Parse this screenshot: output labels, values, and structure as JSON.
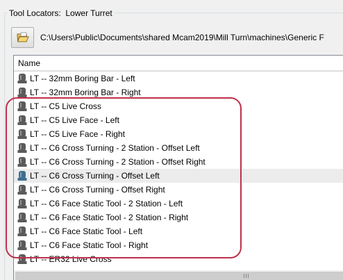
{
  "group": {
    "title": "Tool Locators:  Lower Turret"
  },
  "path": {
    "button_icon": "folder-open-icon",
    "text": "C:\\Users\\Public\\Documents\\shared Mcam2019\\Mill Turn\\machines\\Generic F"
  },
  "list": {
    "column_header": "Name",
    "items": [
      {
        "label": "LT -- 32mm Boring Bar - Left",
        "icon": "tool-locator-icon"
      },
      {
        "label": "LT -- 32mm Boring Bar - Right",
        "icon": "tool-locator-icon"
      },
      {
        "label": "LT -- C5 Live Cross",
        "icon": "tool-locator-icon"
      },
      {
        "label": "LT -- C5 Live Face - Left",
        "icon": "tool-locator-icon"
      },
      {
        "label": "LT -- C5 Live Face - Right",
        "icon": "tool-locator-icon"
      },
      {
        "label": "LT -- C6 Cross Turning - 2 Station - Offset Left",
        "icon": "tool-locator-icon"
      },
      {
        "label": "LT -- C6 Cross Turning - 2 Station - Offset Right",
        "icon": "tool-locator-icon"
      },
      {
        "label": "LT -- C6 Cross Turning - Offset Left",
        "icon": "tool-locator-icon",
        "selected": true
      },
      {
        "label": "LT -- C6 Cross Turning - Offset Right",
        "icon": "tool-locator-icon"
      },
      {
        "label": "LT -- C6 Face Static Tool - 2 Station - Left",
        "icon": "tool-locator-icon"
      },
      {
        "label": "LT -- C6 Face Static Tool - 2 Station - Right",
        "icon": "tool-locator-icon"
      },
      {
        "label": "LT -- C6 Face Static Tool - Left",
        "icon": "tool-locator-icon"
      },
      {
        "label": "LT -- C6 Face Static Tool - Right",
        "icon": "tool-locator-icon"
      },
      {
        "label": "LT -- ER32 Live Cross",
        "icon": "tool-locator-icon"
      }
    ]
  },
  "colors": {
    "highlight": "#c0304b",
    "selected_row": "#ececec",
    "icon_normal": "#5a5a5a",
    "icon_selected": "#3f6f8f"
  }
}
